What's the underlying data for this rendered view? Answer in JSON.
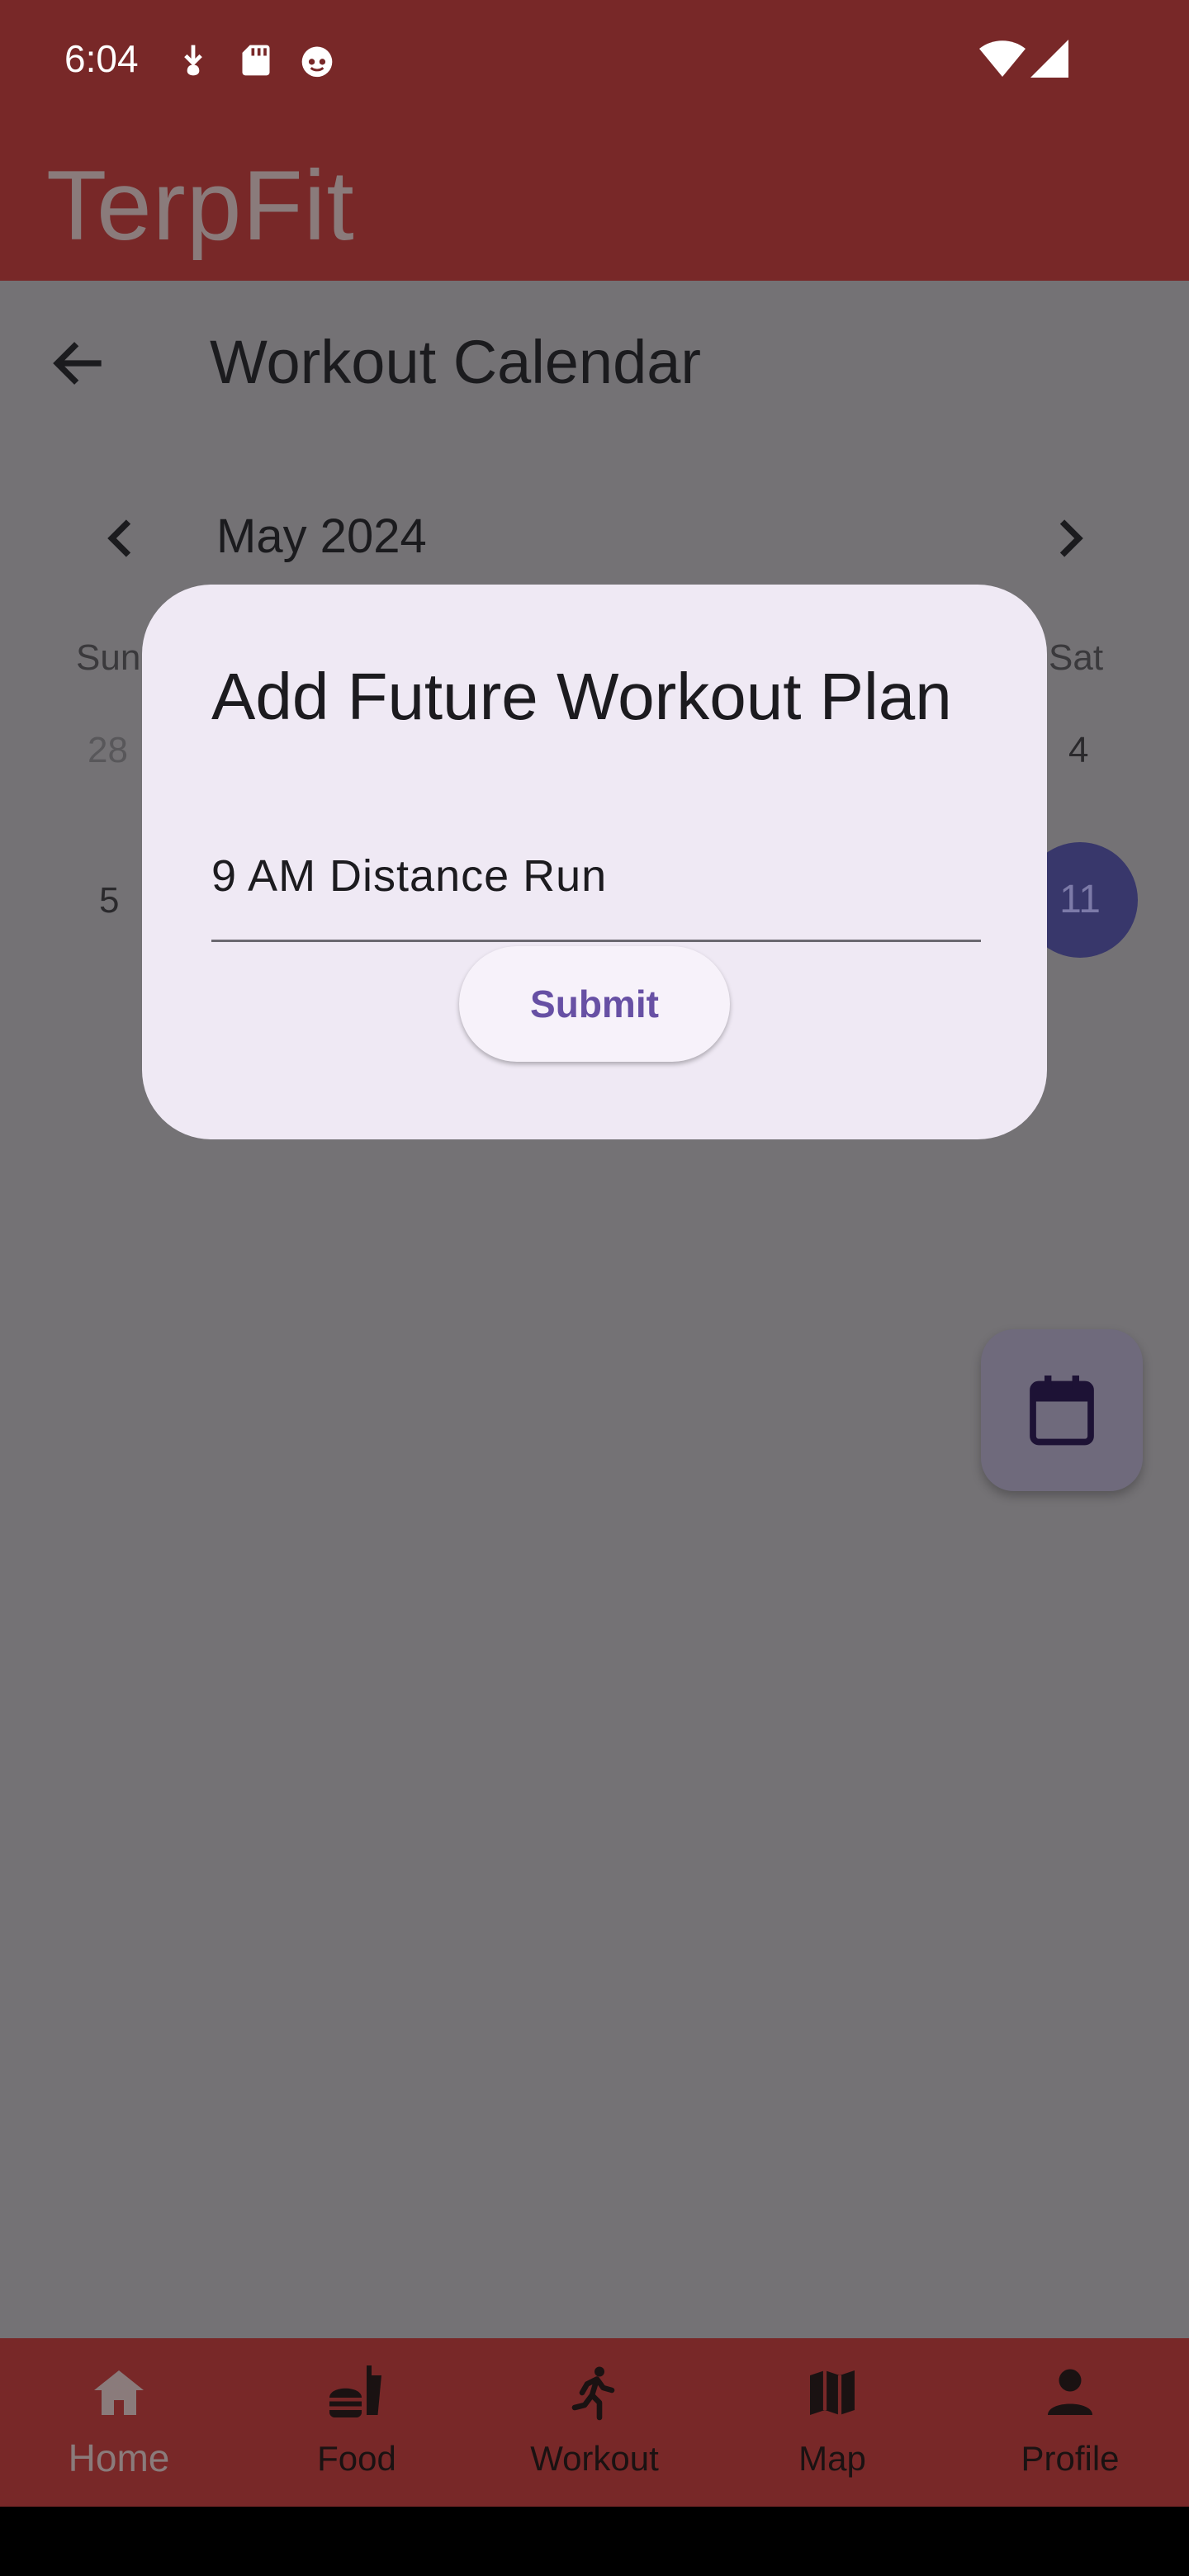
{
  "status_bar": {
    "time": "6:04",
    "left_icons": [
      "download-icon",
      "sd-card-icon",
      "face-icon"
    ],
    "right_icons": [
      "wifi-icon",
      "cell-signal-icon"
    ]
  },
  "app_bar": {
    "title": "TerpFit"
  },
  "screen": {
    "title": "Workout Calendar",
    "back_icon": "arrow-back-icon"
  },
  "calendar": {
    "month_label": "May 2024",
    "weekday_first": "Sun",
    "weekday_last": "Sat",
    "row1_first": "28",
    "row1_last": "4",
    "row2_first": "5",
    "selected_day": "11"
  },
  "dialog": {
    "title": "Add Future Workout Plan",
    "input_value": "9 AM Distance Run",
    "submit_label": "Submit"
  },
  "fab": {
    "icon": "calendar-icon"
  },
  "bottom_nav": {
    "items": [
      {
        "label": "Home",
        "icon": "home-icon",
        "active": true
      },
      {
        "label": "Food",
        "icon": "fastfood-icon",
        "active": false
      },
      {
        "label": "Workout",
        "icon": "run-icon",
        "active": false
      },
      {
        "label": "Map",
        "icon": "map-icon",
        "active": false
      },
      {
        "label": "Profile",
        "icon": "person-icon",
        "active": false
      }
    ]
  },
  "colors": {
    "primary_dim": "#782828",
    "scrim": "#747275",
    "dialog_surface": "#efe9f4",
    "accent": "#6750a4"
  }
}
